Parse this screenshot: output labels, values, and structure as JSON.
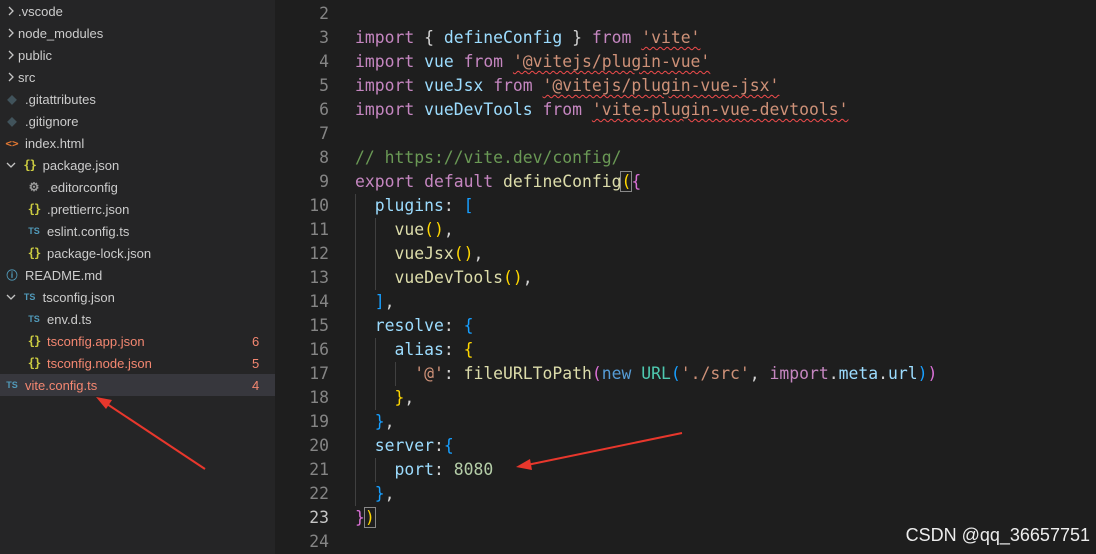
{
  "explorer": {
    "items": [
      {
        "label": ".vscode",
        "icon": "chevron-right-icon",
        "kind": "folder",
        "indent": 0
      },
      {
        "label": "node_modules",
        "icon": "chevron-right-icon",
        "kind": "folder",
        "indent": 0
      },
      {
        "label": "public",
        "icon": "chevron-right-icon",
        "kind": "folder",
        "indent": 0
      },
      {
        "label": "src",
        "icon": "chevron-right-icon",
        "kind": "folder",
        "indent": 0
      },
      {
        "label": ".gitattributes",
        "icon": "git-icon",
        "kind": "file",
        "indent": 0
      },
      {
        "label": ".gitignore",
        "icon": "git-icon",
        "kind": "file",
        "indent": 0
      },
      {
        "label": "index.html",
        "icon": "html-icon",
        "kind": "file",
        "indent": 0
      },
      {
        "label": "package.json",
        "icon": "json-icon",
        "kind": "folder-open",
        "indent": 0
      },
      {
        "label": ".editorconfig",
        "icon": "gear-icon",
        "kind": "file",
        "indent": 1
      },
      {
        "label": ".prettierrc.json",
        "icon": "json-icon",
        "kind": "file",
        "indent": 1
      },
      {
        "label": "eslint.config.ts",
        "icon": "ts-icon",
        "kind": "file",
        "indent": 1
      },
      {
        "label": "package-lock.json",
        "icon": "json-icon",
        "kind": "file",
        "indent": 1
      },
      {
        "label": "README.md",
        "icon": "info-icon",
        "kind": "file",
        "indent": 0
      },
      {
        "label": "tsconfig.json",
        "icon": "ts-icon",
        "kind": "folder-open",
        "indent": 0
      },
      {
        "label": "env.d.ts",
        "icon": "ts-icon",
        "kind": "file",
        "indent": 1
      },
      {
        "label": "tsconfig.app.json",
        "icon": "json-icon",
        "kind": "file",
        "indent": 1,
        "error": true,
        "badge": "6"
      },
      {
        "label": "tsconfig.node.json",
        "icon": "json-icon",
        "kind": "file",
        "indent": 1,
        "error": true,
        "badge": "5"
      },
      {
        "label": "vite.config.ts",
        "icon": "ts-icon",
        "kind": "file",
        "indent": 0,
        "error": true,
        "badge": "4",
        "selected": true
      }
    ]
  },
  "editor": {
    "active_line": "23",
    "lines": [
      {
        "n": "2"
      },
      {
        "n": "3"
      },
      {
        "n": "4"
      },
      {
        "n": "5"
      },
      {
        "n": "6"
      },
      {
        "n": "7"
      },
      {
        "n": "8"
      },
      {
        "n": "9"
      },
      {
        "n": "10"
      },
      {
        "n": "11"
      },
      {
        "n": "12"
      },
      {
        "n": "13"
      },
      {
        "n": "14"
      },
      {
        "n": "15"
      },
      {
        "n": "16"
      },
      {
        "n": "17"
      },
      {
        "n": "18"
      },
      {
        "n": "19"
      },
      {
        "n": "20"
      },
      {
        "n": "21"
      },
      {
        "n": "22"
      },
      {
        "n": "23"
      },
      {
        "n": "24"
      }
    ],
    "tokens": {
      "l3": [
        "import",
        " { ",
        "defineConfig",
        " } ",
        "from",
        " ",
        "'vite'"
      ],
      "l4": [
        "import",
        " ",
        "vue",
        " ",
        "from",
        " ",
        "'@vitejs/plugin-vue'"
      ],
      "l5": [
        "import",
        " ",
        "vueJsx",
        " ",
        "from",
        " ",
        "'@vitejs/plugin-vue-jsx'"
      ],
      "l6": [
        "import",
        " ",
        "vueDevTools",
        " ",
        "from",
        " ",
        "'vite-plugin-vue-devtools'"
      ],
      "l8": [
        "// https://vite.dev/config/"
      ],
      "l9": [
        "export",
        " ",
        "default",
        " ",
        "defineConfig",
        "(",
        "{"
      ],
      "l10": [
        "plugins",
        ": ",
        "["
      ],
      "l11": [
        "vue",
        "()",
        ","
      ],
      "l12": [
        "vueJsx",
        "()",
        ","
      ],
      "l13": [
        "vueDevTools",
        "()",
        ","
      ],
      "l14": [
        "]",
        ","
      ],
      "l15": [
        "resolve",
        ": ",
        "{"
      ],
      "l16": [
        "alias",
        ": ",
        "{"
      ],
      "l17": [
        "'@'",
        ": ",
        "fileURLToPath",
        "(",
        "new",
        " ",
        "URL",
        "(",
        "'./src'",
        ", ",
        "import",
        ".",
        "meta",
        ".",
        "url",
        ")",
        ")"
      ],
      "l18": [
        "}",
        ","
      ],
      "l19": [
        "}",
        ","
      ],
      "l20": [
        "server",
        ":",
        "{"
      ],
      "l21": [
        "port",
        ": ",
        "8080"
      ],
      "l22": [
        "}",
        ","
      ],
      "l23": [
        "}",
        ")"
      ]
    }
  },
  "watermark": "CSDN @qq_36657751",
  "colors": {
    "annotation_arrow": "#e8372c",
    "error": "#f48771",
    "background": "#1e1e1e",
    "sidebar": "#252526"
  }
}
